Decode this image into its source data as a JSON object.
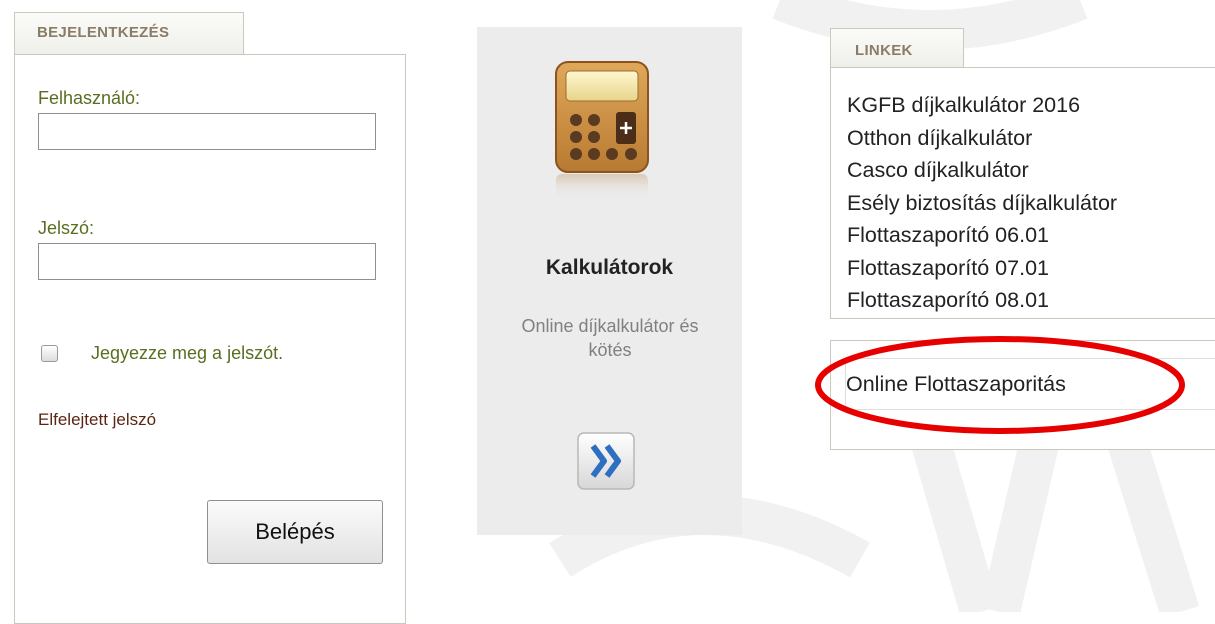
{
  "login": {
    "tab_title": "BEJELENTKEZÉS",
    "username_label": "Felhasználó:",
    "username_value": "",
    "password_label": "Jelszó:",
    "password_value": "",
    "remember_label": "Jegyezze meg a jelszót.",
    "remember_checked": false,
    "forgot_link": "Elfelejtett jelszó",
    "submit_label": "Belépés"
  },
  "calculator": {
    "icon": "calculator-icon",
    "title": "Kalkulátorok",
    "description": "Online díjkalkulátor és kötés",
    "go_icon": "double-chevron-right-icon"
  },
  "links": {
    "tab_title": "LINKEK",
    "items": [
      {
        "label": "KGFB díjkalkulátor 2016"
      },
      {
        "label": "Otthon díjkalkulátor"
      },
      {
        "label": "Casco díjkalkulátor"
      },
      {
        "label": "Esély biztosítás díjkalkulátor"
      },
      {
        "label": "Flottaszaporító 06.01"
      },
      {
        "label": "Flottaszaporító 07.01"
      },
      {
        "label": "Flottaszaporító 08.01"
      }
    ],
    "highlighted_link": "Online Flottaszaporitás"
  },
  "colors": {
    "tab_text": "#8a7c66",
    "label_green": "#586e20",
    "forgot_brown": "#5a2515",
    "highlight_red": "#e60000",
    "card_bg": "#ececec"
  }
}
